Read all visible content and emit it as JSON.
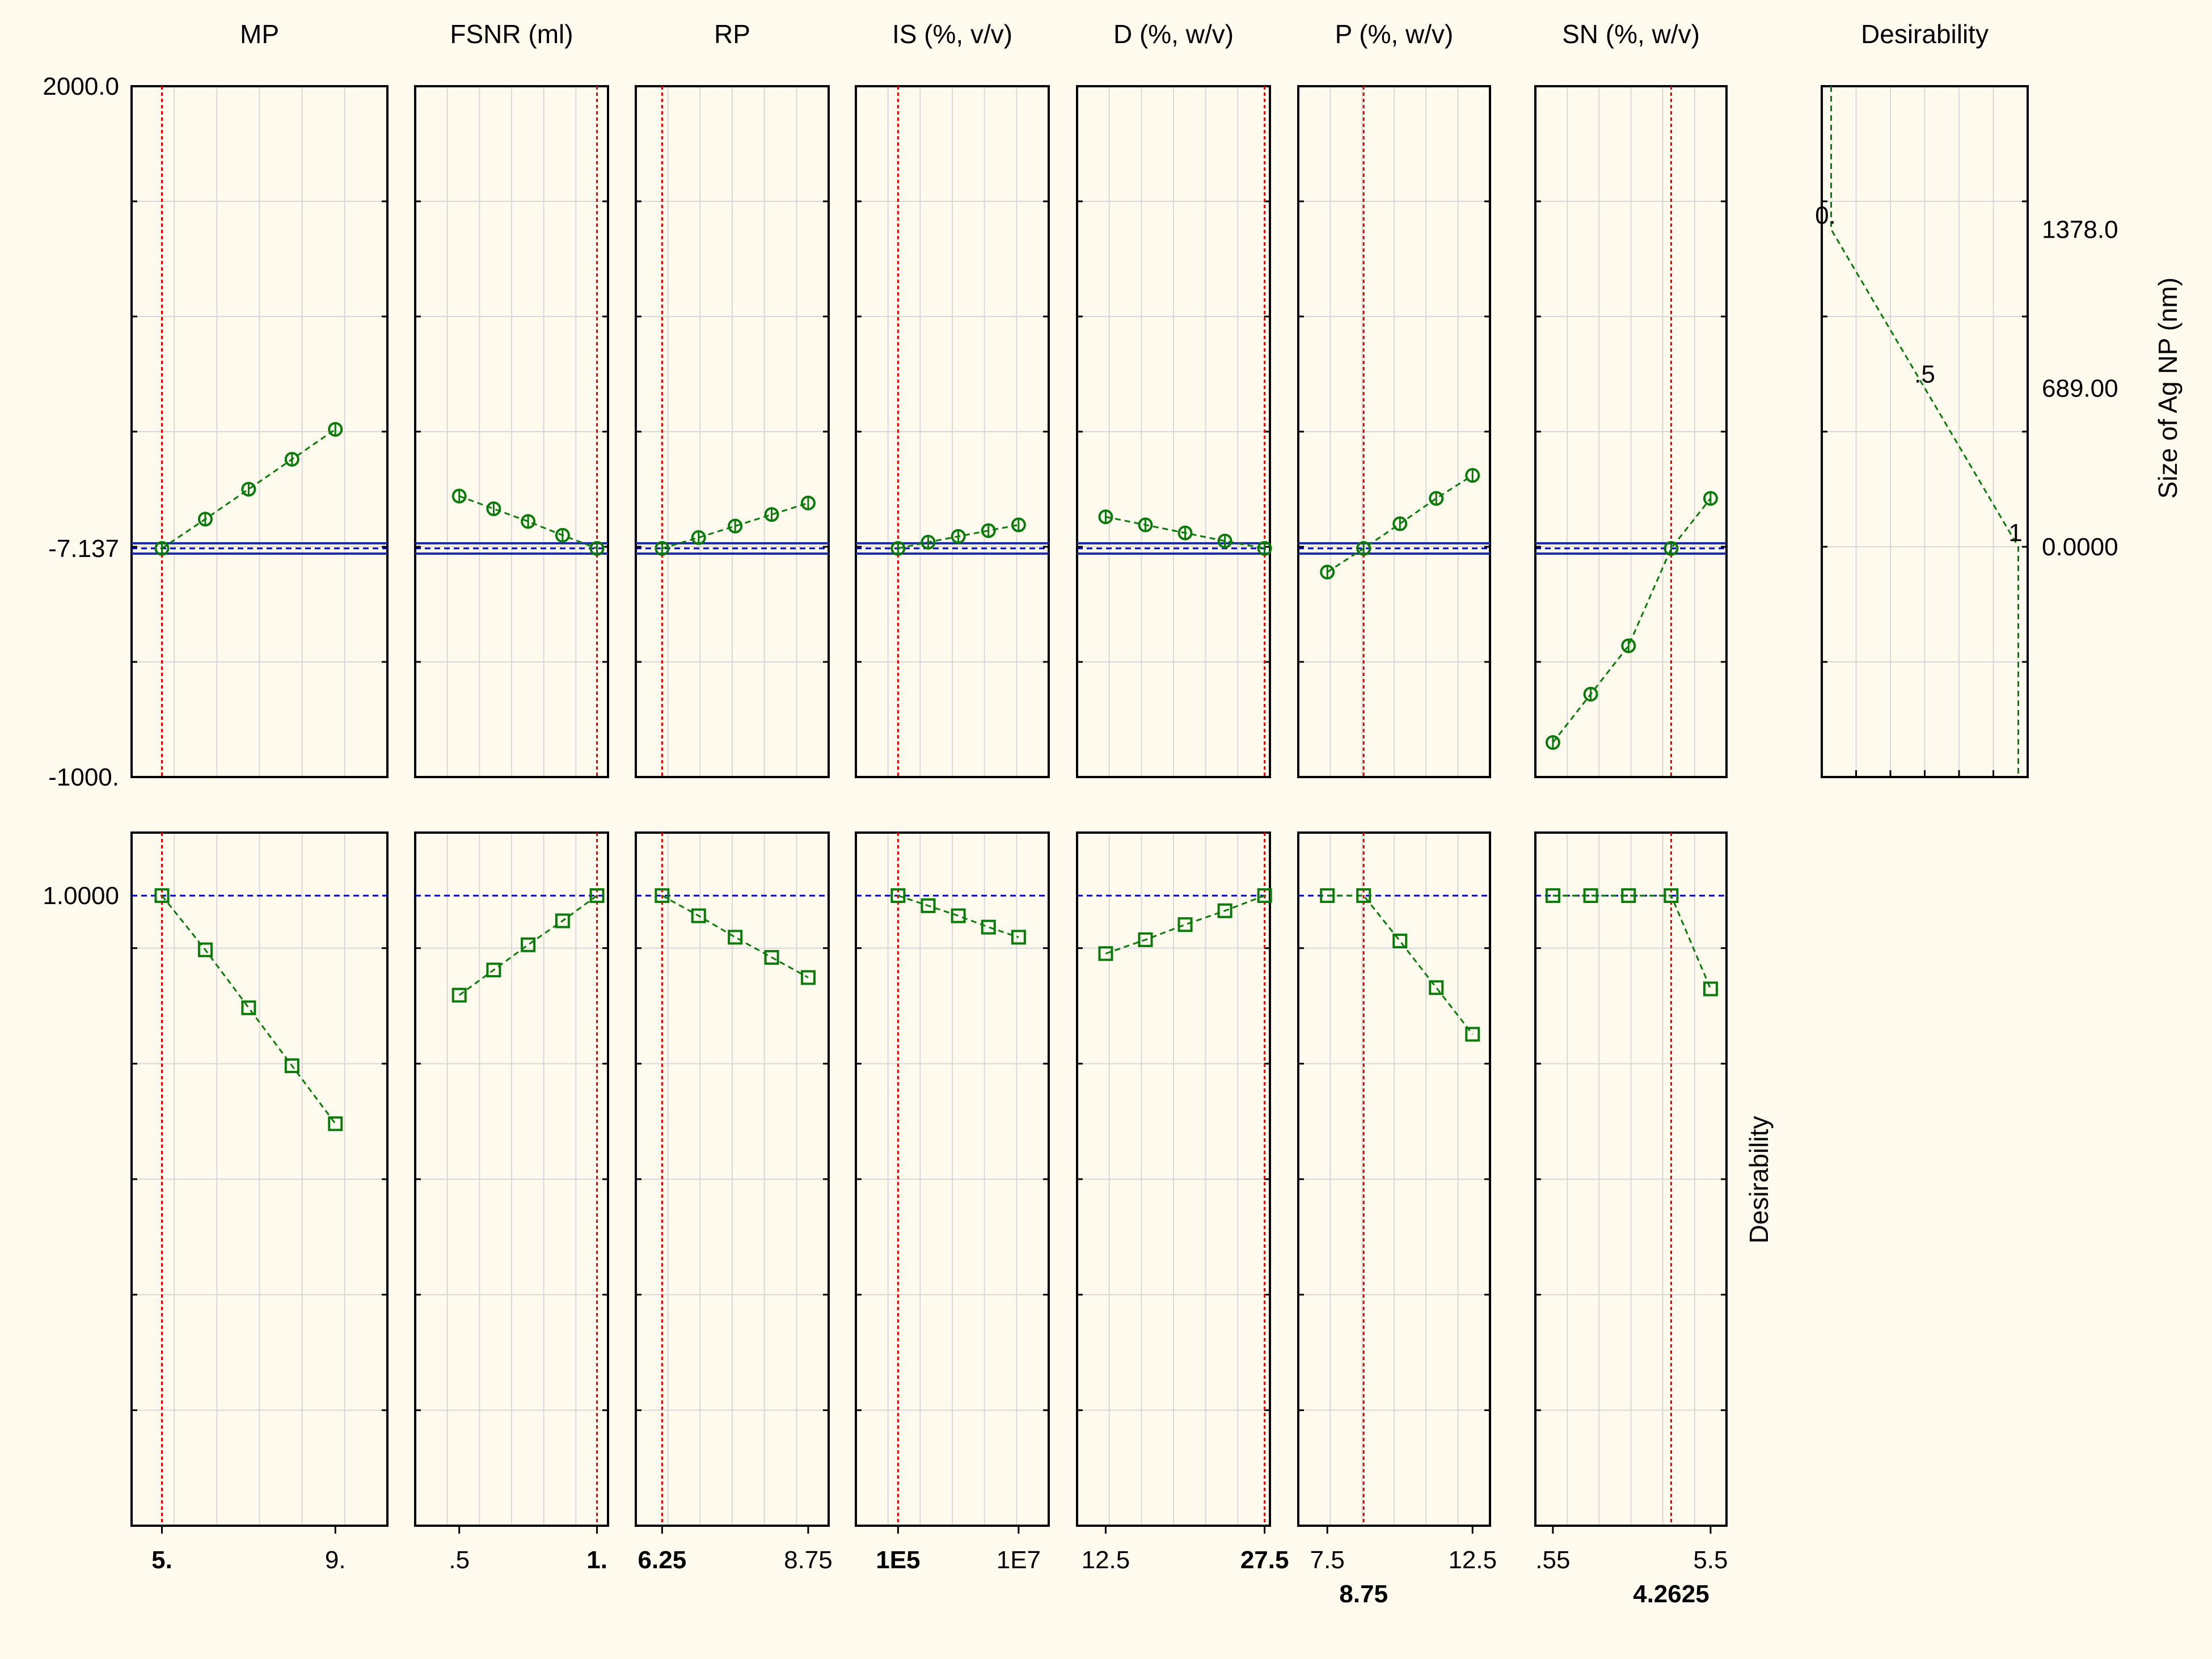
{
  "chart_data": {
    "type": "line",
    "response_label": "Size of Ag NP (nm)",
    "desirability_label": "Desirability",
    "top_ylim": [
      -1000,
      2000
    ],
    "top_yticks": [
      "2000.0",
      "-7.137",
      "-1000."
    ],
    "current_response": -7.137,
    "confidence_band": [
      -30,
      15
    ],
    "bottom_ylim": [
      -1.5,
      1.25
    ],
    "bottom_ytick": "1.0000",
    "factors": [
      {
        "name": "MP",
        "xlim": [
          4.3,
          10.2
        ],
        "x": [
          5,
          6,
          7,
          8,
          9
        ],
        "response": [
          -7.137,
          120,
          250,
          380,
          510
        ],
        "desirability": [
          1.0,
          0.785,
          0.555,
          0.325,
          0.095
        ],
        "current": 5,
        "tick_labels": [
          "5.",
          "9."
        ],
        "tick_x": [
          5,
          9
        ],
        "bold_index": 0,
        "current_label": ""
      },
      {
        "name": "FSNR (ml)",
        "xlim": [
          0.34,
          1.04
        ],
        "x": [
          0.5,
          0.625,
          0.75,
          0.875,
          1.0
        ],
        "response": [
          220,
          165,
          110,
          50,
          -7.137
        ],
        "desirability": [
          0.605,
          0.705,
          0.805,
          0.9,
          1.0
        ],
        "current": 1.0,
        "tick_labels": [
          ".5",
          "1."
        ],
        "tick_x": [
          0.5,
          1.0
        ],
        "bold_index": 1,
        "current_label": ""
      },
      {
        "name": "RP",
        "xlim": [
          5.8,
          9.1
        ],
        "x": [
          6.25,
          6.875,
          7.5,
          8.125,
          8.75
        ],
        "response": [
          -7.137,
          40,
          90,
          140,
          190
        ],
        "desirability": [
          1.0,
          0.92,
          0.835,
          0.755,
          0.675
        ],
        "current": 6.25,
        "tick_labels": [
          "6.25",
          "8.75"
        ],
        "tick_x": [
          6.25,
          8.75
        ],
        "bold_index": 0,
        "current_label": ""
      },
      {
        "name": "IS  (%, v/v)",
        "xlim": [
          4.3,
          7.5
        ],
        "x": [
          5,
          5.5,
          6,
          6.5,
          7
        ],
        "response": [
          -7.137,
          20,
          45,
          70,
          95
        ],
        "desirability": [
          1.0,
          0.96,
          0.92,
          0.875,
          0.835
        ],
        "current": 5,
        "tick_labels": [
          "1E5",
          "1E7"
        ],
        "tick_x": [
          5,
          7
        ],
        "bold_index": 0,
        "current_label": ""
      },
      {
        "name": "D (%, w/v)",
        "xlim": [
          9.8,
          28.0
        ],
        "x": [
          12.5,
          16.25,
          20.0,
          23.75,
          27.5
        ],
        "response": [
          130,
          95,
          60,
          25,
          -7.137
        ],
        "desirability": [
          0.77,
          0.825,
          0.885,
          0.94,
          1.0
        ],
        "current": 27.5,
        "tick_labels": [
          "12.5",
          "27.5"
        ],
        "tick_x": [
          12.5,
          27.5
        ],
        "bold_index": 1,
        "current_label": ""
      },
      {
        "name": "P (%, w/v)",
        "xlim": [
          6.5,
          13.1
        ],
        "x": [
          7.5,
          8.75,
          10.0,
          11.25,
          12.5
        ],
        "response": [
          -110,
          -7.137,
          100,
          210,
          310
        ],
        "desirability": [
          1.0,
          1.0,
          0.82,
          0.635,
          0.45
        ],
        "current": 8.75,
        "tick_labels": [
          "7.5",
          "12.5"
        ],
        "tick_x": [
          7.5,
          12.5
        ],
        "bold_index": -1,
        "current_label": "8.75"
      },
      {
        "name": "SN (%, w/v)",
        "xlim": [
          0.0,
          6.0
        ],
        "x": [
          0.55,
          1.7375,
          2.925,
          4.2625,
          5.5
        ],
        "response": [
          -850,
          -640,
          -430,
          -7.137,
          210
        ],
        "desirability": [
          1.0,
          1.0,
          1.0,
          1.0,
          0.63
        ],
        "current": 4.2625,
        "tick_labels": [
          ".55",
          "5.5"
        ],
        "tick_x": [
          0.55,
          5.5
        ],
        "bold_index": -1,
        "current_label": "4.2625"
      }
    ],
    "desirability_panel": {
      "title": "Desirability",
      "xlim": [
        -0.05,
        1.05
      ],
      "response_ylim": [
        -1000,
        2000
      ],
      "curve": [
        [
          0,
          2000
        ],
        [
          0,
          1378
        ],
        [
          1,
          0
        ],
        [
          1,
          -1000
        ]
      ],
      "dlabels": [
        "0.",
        ".5",
        "1"
      ],
      "dlabel_y": [
        1378,
        689,
        0
      ],
      "right_ticks": [
        "1378.0",
        "689.00",
        "0.0000"
      ],
      "right_tick_y": [
        1378,
        689,
        0
      ]
    }
  },
  "colors": {
    "background": "#fefaee",
    "points": "#0a7a0a",
    "current": "#e00000",
    "band": "#1a2aa0",
    "dashed": "#0000cc",
    "grid": "#d8d8d8",
    "axis": "#000000"
  }
}
